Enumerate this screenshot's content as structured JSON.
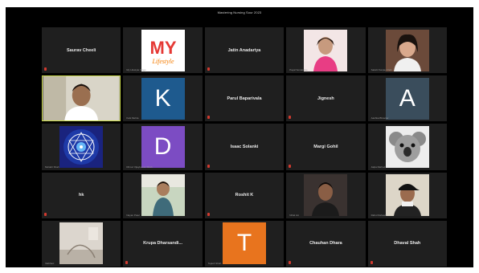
{
  "window": {
    "title": "Mastering Nursing Sour 2023"
  },
  "colors": {
    "speaker_border": "#c8d84a",
    "tile_bg": "#1f1f1f",
    "muted": "#d23a2f"
  },
  "participants": [
    {
      "name": "Saurav Cheeli",
      "type": "text"
    },
    {
      "name": "",
      "type": "logo",
      "logo_text_top": "MY",
      "logo_text_bottom": "Lifestyle",
      "caption": "My Lifestyle Vlogs"
    },
    {
      "name": "Jatin Anadariya",
      "type": "text"
    },
    {
      "name": "",
      "type": "photo",
      "photo": "woman-pink",
      "caption": "Payal Sonawane"
    },
    {
      "name": "",
      "type": "photo",
      "photo": "woman-earphones",
      "caption": "Sakshi Sanjay Patil"
    },
    {
      "name": "",
      "type": "camera",
      "photo": "man-smiling",
      "speaking": true,
      "caption": ""
    },
    {
      "name": "",
      "type": "avatar",
      "letter": "K",
      "color": "#1e5a8e",
      "caption": "Kals Mehta"
    },
    {
      "name": "Parul Baparivala",
      "type": "text"
    },
    {
      "name": "Jignesh",
      "type": "text"
    },
    {
      "name": "",
      "type": "avatar",
      "letter": "A",
      "color": "#3a4d5c",
      "caption": "Aashka Bhavsar"
    },
    {
      "name": "",
      "type": "photo",
      "photo": "mandala",
      "caption": "Moldeh Shah"
    },
    {
      "name": "",
      "type": "avatar",
      "letter": "D",
      "color": "#7c4cc3",
      "caption": "Dhruvi Vijaykumar Shah"
    },
    {
      "name": "Isaac Solanki",
      "type": "text"
    },
    {
      "name": "Margi Gohil",
      "type": "text"
    },
    {
      "name": "",
      "type": "photo",
      "photo": "koala",
      "caption": "Jalpa Rathod"
    },
    {
      "name": "hk",
      "type": "text"
    },
    {
      "name": "",
      "type": "photo",
      "photo": "man-outdoor",
      "caption": "Nayan Patel"
    },
    {
      "name": "Roshit K",
      "type": "text"
    },
    {
      "name": "",
      "type": "photo",
      "photo": "man-dark",
      "caption": "Nihal Jot"
    },
    {
      "name": "",
      "type": "photo",
      "photo": "man-cap",
      "caption": "Rahul Dalwadi"
    },
    {
      "name": "",
      "type": "photo",
      "photo": "room",
      "caption": "Vaibhavi"
    },
    {
      "name": "Krupa Dharsandi...",
      "type": "text"
    },
    {
      "name": "",
      "type": "avatar",
      "letter": "T",
      "color": "#e8741e",
      "caption": "Tejash Shah"
    },
    {
      "name": "Chauhan Dhara",
      "type": "text"
    },
    {
      "name": "Dhaval Shah",
      "type": "text"
    }
  ]
}
